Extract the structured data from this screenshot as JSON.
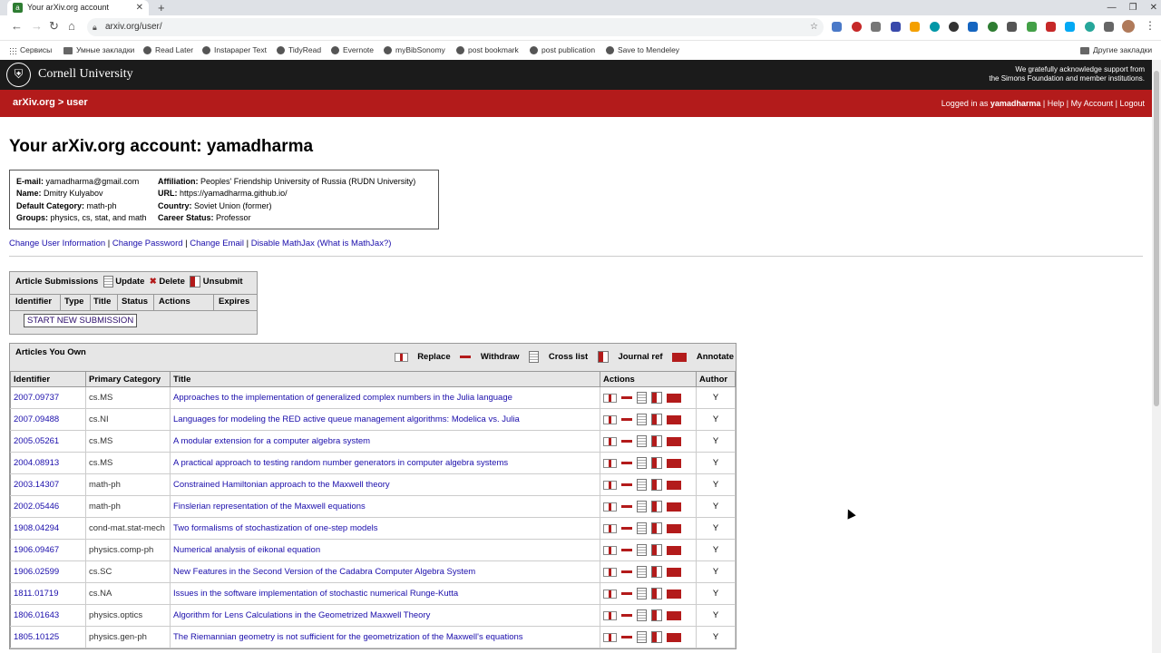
{
  "browser": {
    "tab_title": "Your arXiv.org account",
    "url": "arxiv.org/user/",
    "bookmarks": [
      "Сервисы",
      "Умные закладки",
      "Read Later",
      "Instapaper Text",
      "TidyRead",
      "Evernote",
      "myBibSonomy",
      "post bookmark",
      "post publication",
      "Save to Mendeley"
    ],
    "other_bookmarks": "Другие закладки"
  },
  "header": {
    "university": "Cornell University",
    "ack_line1": "We gratefully acknowledge support from",
    "ack_line2": "the Simons Foundation and member institutions.",
    "breadcrumb": "arXiv.org > user",
    "logged_in_prefix": "Logged in as",
    "username": "yamadharma",
    "help": "Help",
    "my_account": "My Account",
    "logout": "Logout"
  },
  "page_title": "Your arXiv.org account: yamadharma",
  "account": {
    "email_label": "E-mail:",
    "email": "yamadharma@gmail.com",
    "name_label": "Name:",
    "name": "Dmitry Kulyabov",
    "default_cat_label": "Default Category:",
    "default_cat": "math-ph",
    "groups_label": "Groups:",
    "groups": "physics, cs, stat, and math",
    "affiliation_label": "Affiliation:",
    "affiliation": "Peoples' Friendship University of Russia (RUDN University)",
    "url_label": "URL:",
    "url": "https://yamadharma.github.io/",
    "country_label": "Country:",
    "country": "Soviet Union (former)",
    "career_label": "Career Status:",
    "career": "Professor"
  },
  "account_links": {
    "change_info": "Change User Information",
    "change_password": "Change Password",
    "change_email": "Change Email",
    "disable_mathjax": "Disable MathJax",
    "what_mathjax": "(What is MathJax?)"
  },
  "submissions": {
    "title": "Article Submissions",
    "update": "Update",
    "delete": "Delete",
    "unsubmit": "Unsubmit",
    "columns": [
      "Identifier",
      "Type",
      "Title",
      "Status",
      "Actions",
      "Expires"
    ],
    "start_button": "START NEW SUBMISSION"
  },
  "owned": {
    "title": "Articles You Own",
    "legend": [
      "Replace",
      "Withdraw",
      "Cross list",
      "Journal ref",
      "Annotate"
    ],
    "columns": [
      "Identifier",
      "Primary Category",
      "Title",
      "Actions",
      "Author"
    ],
    "rows": [
      {
        "id": "2007.09737",
        "cat": "cs.MS",
        "title": "Approaches to the implementation of generalized complex numbers in the Julia language",
        "author": "Y"
      },
      {
        "id": "2007.09488",
        "cat": "cs.NI",
        "title": "Languages for modeling the RED active queue management algorithms: Modelica vs. Julia",
        "author": "Y"
      },
      {
        "id": "2005.05261",
        "cat": "cs.MS",
        "title": "A modular extension for a computer algebra system",
        "author": "Y"
      },
      {
        "id": "2004.08913",
        "cat": "cs.MS",
        "title": "A practical approach to testing random number generators in computer algebra systems",
        "author": "Y"
      },
      {
        "id": "2003.14307",
        "cat": "math-ph",
        "title": "Constrained Hamiltonian approach to the Maxwell theory",
        "author": "Y"
      },
      {
        "id": "2002.05446",
        "cat": "math-ph",
        "title": "Finslerian representation of the Maxwell equations",
        "author": "Y"
      },
      {
        "id": "1908.04294",
        "cat": "cond-mat.stat-mech",
        "title": "Two formalisms of stochastization of one-step models",
        "author": "Y"
      },
      {
        "id": "1906.09467",
        "cat": "physics.comp-ph",
        "title": "Numerical analysis of eikonal equation",
        "author": "Y"
      },
      {
        "id": "1906.02599",
        "cat": "cs.SC",
        "title": "New Features in the Second Version of the Cadabra Computer Algebra System",
        "author": "Y"
      },
      {
        "id": "1811.01719",
        "cat": "cs.NA",
        "title": "Issues in the software implementation of stochastic numerical Runge-Kutta",
        "author": "Y"
      },
      {
        "id": "1806.01643",
        "cat": "physics.optics",
        "title": "Algorithm for Lens Calculations in the Geometrized Maxwell Theory",
        "author": "Y"
      },
      {
        "id": "1805.10125",
        "cat": "physics.gen-ph",
        "title": "The Riemannian geometry is not sufficient for the geometrization of the Maxwell's equations",
        "author": "Y"
      }
    ]
  }
}
